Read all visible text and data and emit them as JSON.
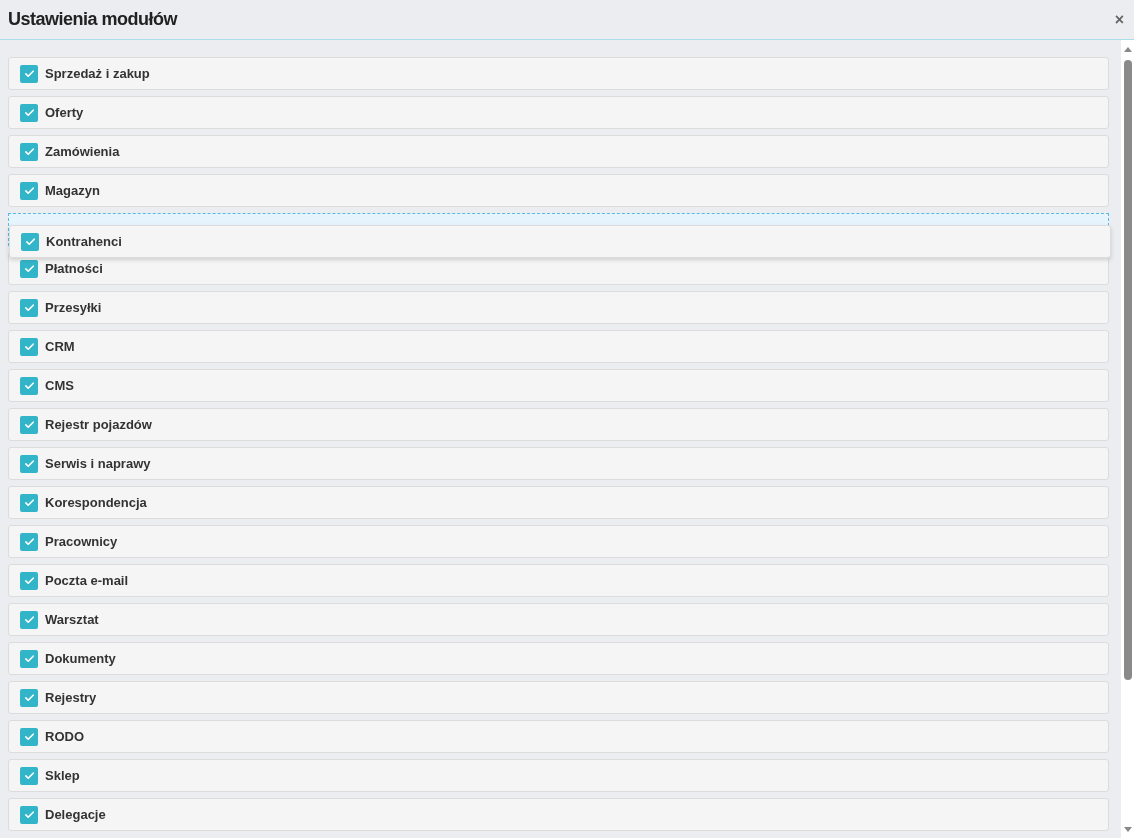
{
  "dialog": {
    "title": "Ustawienia modułów",
    "close": "×"
  },
  "modules": [
    {
      "label": "Sprzedaż i zakup",
      "checked": true,
      "dragging": false
    },
    {
      "label": "Oferty",
      "checked": true,
      "dragging": false
    },
    {
      "label": "Zamówienia",
      "checked": true,
      "dragging": false
    },
    {
      "label": "Magazyn",
      "checked": true,
      "dragging": false
    },
    {
      "label": "Kontrahenci",
      "checked": true,
      "dragging": true
    },
    {
      "label": "Płatności",
      "checked": true,
      "dragging": false
    },
    {
      "label": "Przesyłki",
      "checked": true,
      "dragging": false
    },
    {
      "label": "CRM",
      "checked": true,
      "dragging": false
    },
    {
      "label": "CMS",
      "checked": true,
      "dragging": false
    },
    {
      "label": "Rejestr pojazdów",
      "checked": true,
      "dragging": false
    },
    {
      "label": "Serwis i naprawy",
      "checked": true,
      "dragging": false
    },
    {
      "label": "Korespondencja",
      "checked": true,
      "dragging": false
    },
    {
      "label": "Pracownicy",
      "checked": true,
      "dragging": false
    },
    {
      "label": "Poczta e-mail",
      "checked": true,
      "dragging": false
    },
    {
      "label": "Warsztat",
      "checked": true,
      "dragging": false
    },
    {
      "label": "Dokumenty",
      "checked": true,
      "dragging": false
    },
    {
      "label": "Rejestry",
      "checked": true,
      "dragging": false
    },
    {
      "label": "RODO",
      "checked": true,
      "dragging": false
    },
    {
      "label": "Sklep",
      "checked": true,
      "dragging": false
    },
    {
      "label": "Delegacje",
      "checked": true,
      "dragging": false
    }
  ]
}
